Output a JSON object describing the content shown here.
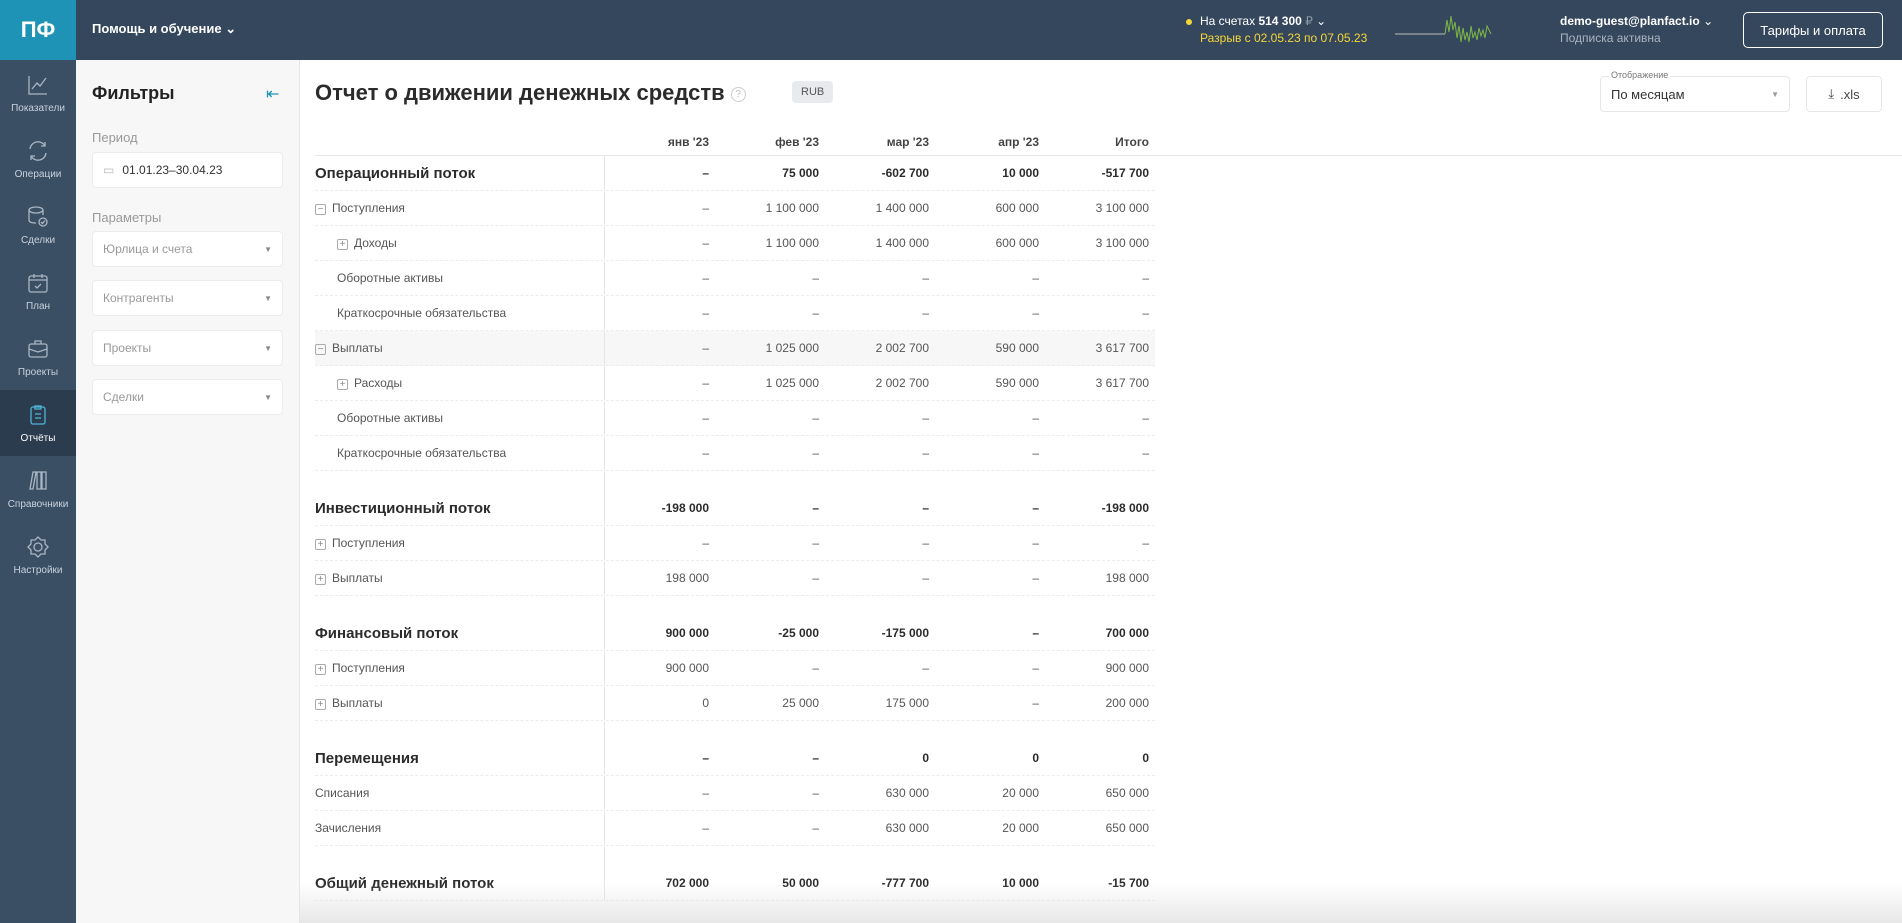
{
  "header": {
    "logo": "ПФ",
    "help": "Помощь и обучение",
    "balance_label": "На счетах",
    "balance_value": "514 300",
    "currency": "₽",
    "gap": "Разрыв с 02.05.23 по 07.05.23",
    "user": "demo-guest@planfact.io",
    "subscription": "Подписка активна",
    "tariff_button": "Тарифы и оплата",
    "accent": "#1f93b5",
    "warning_color": "#f5d63a"
  },
  "nav": [
    {
      "label": "Показатели",
      "icon": "chart-icon"
    },
    {
      "label": "Операции",
      "icon": "refresh-icon"
    },
    {
      "label": "Сделки",
      "icon": "database-check-icon"
    },
    {
      "label": "План",
      "icon": "calendar-icon"
    },
    {
      "label": "Проекты",
      "icon": "briefcase-icon"
    },
    {
      "label": "Отчёты",
      "icon": "clipboard-icon",
      "active": true
    },
    {
      "label": "Справочники",
      "icon": "books-icon"
    },
    {
      "label": "Настройки",
      "icon": "gear-icon"
    }
  ],
  "filters": {
    "title": "Фильтры",
    "period_label": "Период",
    "period_value": "01.01.23–30.04.23",
    "params_label": "Параметры",
    "selects": [
      "Юрлица и счета",
      "Контрагенты",
      "Проекты",
      "Сделки"
    ]
  },
  "report": {
    "title": "Отчет о движении денежных средств",
    "currency_badge": "RUB",
    "display_label": "Отображение",
    "display_value": "По месяцам",
    "export_label": ".xls",
    "columns": [
      "янв '23",
      "фев '23",
      "мар '23",
      "апр '23",
      "Итого"
    ],
    "rows": [
      {
        "type": "sec",
        "label": "Операционный поток",
        "values": [
          "–",
          "75 000",
          "-602 700",
          "10 000",
          "-517 700"
        ]
      },
      {
        "type": "l1",
        "toggle": "−",
        "label": "Поступления",
        "values": [
          "–",
          "1 100 000",
          "1 400 000",
          "600 000",
          "3 100 000"
        ]
      },
      {
        "type": "l2",
        "toggle": "+",
        "label": "Доходы",
        "values": [
          "–",
          "1 100 000",
          "1 400 000",
          "600 000",
          "3 100 000"
        ]
      },
      {
        "type": "l2n",
        "label": "Оборотные активы",
        "values": [
          "–",
          "–",
          "–",
          "–",
          "–"
        ]
      },
      {
        "type": "l2n",
        "label": "Краткосрочные обязательства",
        "values": [
          "–",
          "–",
          "–",
          "–",
          "–"
        ]
      },
      {
        "type": "l1",
        "toggle": "−",
        "label": "Выплаты",
        "values": [
          "–",
          "1 025 000",
          "2 002 700",
          "590 000",
          "3 617 700"
        ],
        "hover": true
      },
      {
        "type": "l2",
        "toggle": "+",
        "label": "Расходы",
        "values": [
          "–",
          "1 025 000",
          "2 002 700",
          "590 000",
          "3 617 700"
        ]
      },
      {
        "type": "l2n",
        "label": "Оборотные активы",
        "values": [
          "–",
          "–",
          "–",
          "–",
          "–"
        ]
      },
      {
        "type": "l2n",
        "label": "Краткосрочные обязательства",
        "values": [
          "–",
          "–",
          "–",
          "–",
          "–"
        ]
      },
      {
        "type": "spacer"
      },
      {
        "type": "sec",
        "label": "Инвестиционный поток",
        "values": [
          "-198 000",
          "–",
          "–",
          "–",
          "-198 000"
        ]
      },
      {
        "type": "l1",
        "toggle": "+",
        "label": "Поступления",
        "values": [
          "–",
          "–",
          "–",
          "–",
          "–"
        ]
      },
      {
        "type": "l1",
        "toggle": "+",
        "label": "Выплаты",
        "values": [
          "198 000",
          "–",
          "–",
          "–",
          "198 000"
        ]
      },
      {
        "type": "spacer"
      },
      {
        "type": "sec",
        "label": "Финансовый поток",
        "values": [
          "900 000",
          "-25 000",
          "-175 000",
          "–",
          "700 000"
        ]
      },
      {
        "type": "l1",
        "toggle": "+",
        "label": "Поступления",
        "values": [
          "900 000",
          "–",
          "–",
          "–",
          "900 000"
        ]
      },
      {
        "type": "l1",
        "toggle": "+",
        "label": "Выплаты",
        "values": [
          "0",
          "25 000",
          "175 000",
          "–",
          "200 000"
        ]
      },
      {
        "type": "spacer"
      },
      {
        "type": "sec",
        "label": "Перемещения",
        "values": [
          "–",
          "–",
          "0",
          "0",
          "0"
        ]
      },
      {
        "type": "l0",
        "label": "Списания",
        "values": [
          "–",
          "–",
          "630 000",
          "20 000",
          "650 000"
        ]
      },
      {
        "type": "l0",
        "label": "Зачисления",
        "values": [
          "–",
          "–",
          "630 000",
          "20 000",
          "650 000"
        ]
      },
      {
        "type": "spacer"
      },
      {
        "type": "sec",
        "label": "Общий денежный поток",
        "values": [
          "702 000",
          "50 000",
          "-777 700",
          "10 000",
          "-15 700"
        ]
      }
    ]
  }
}
